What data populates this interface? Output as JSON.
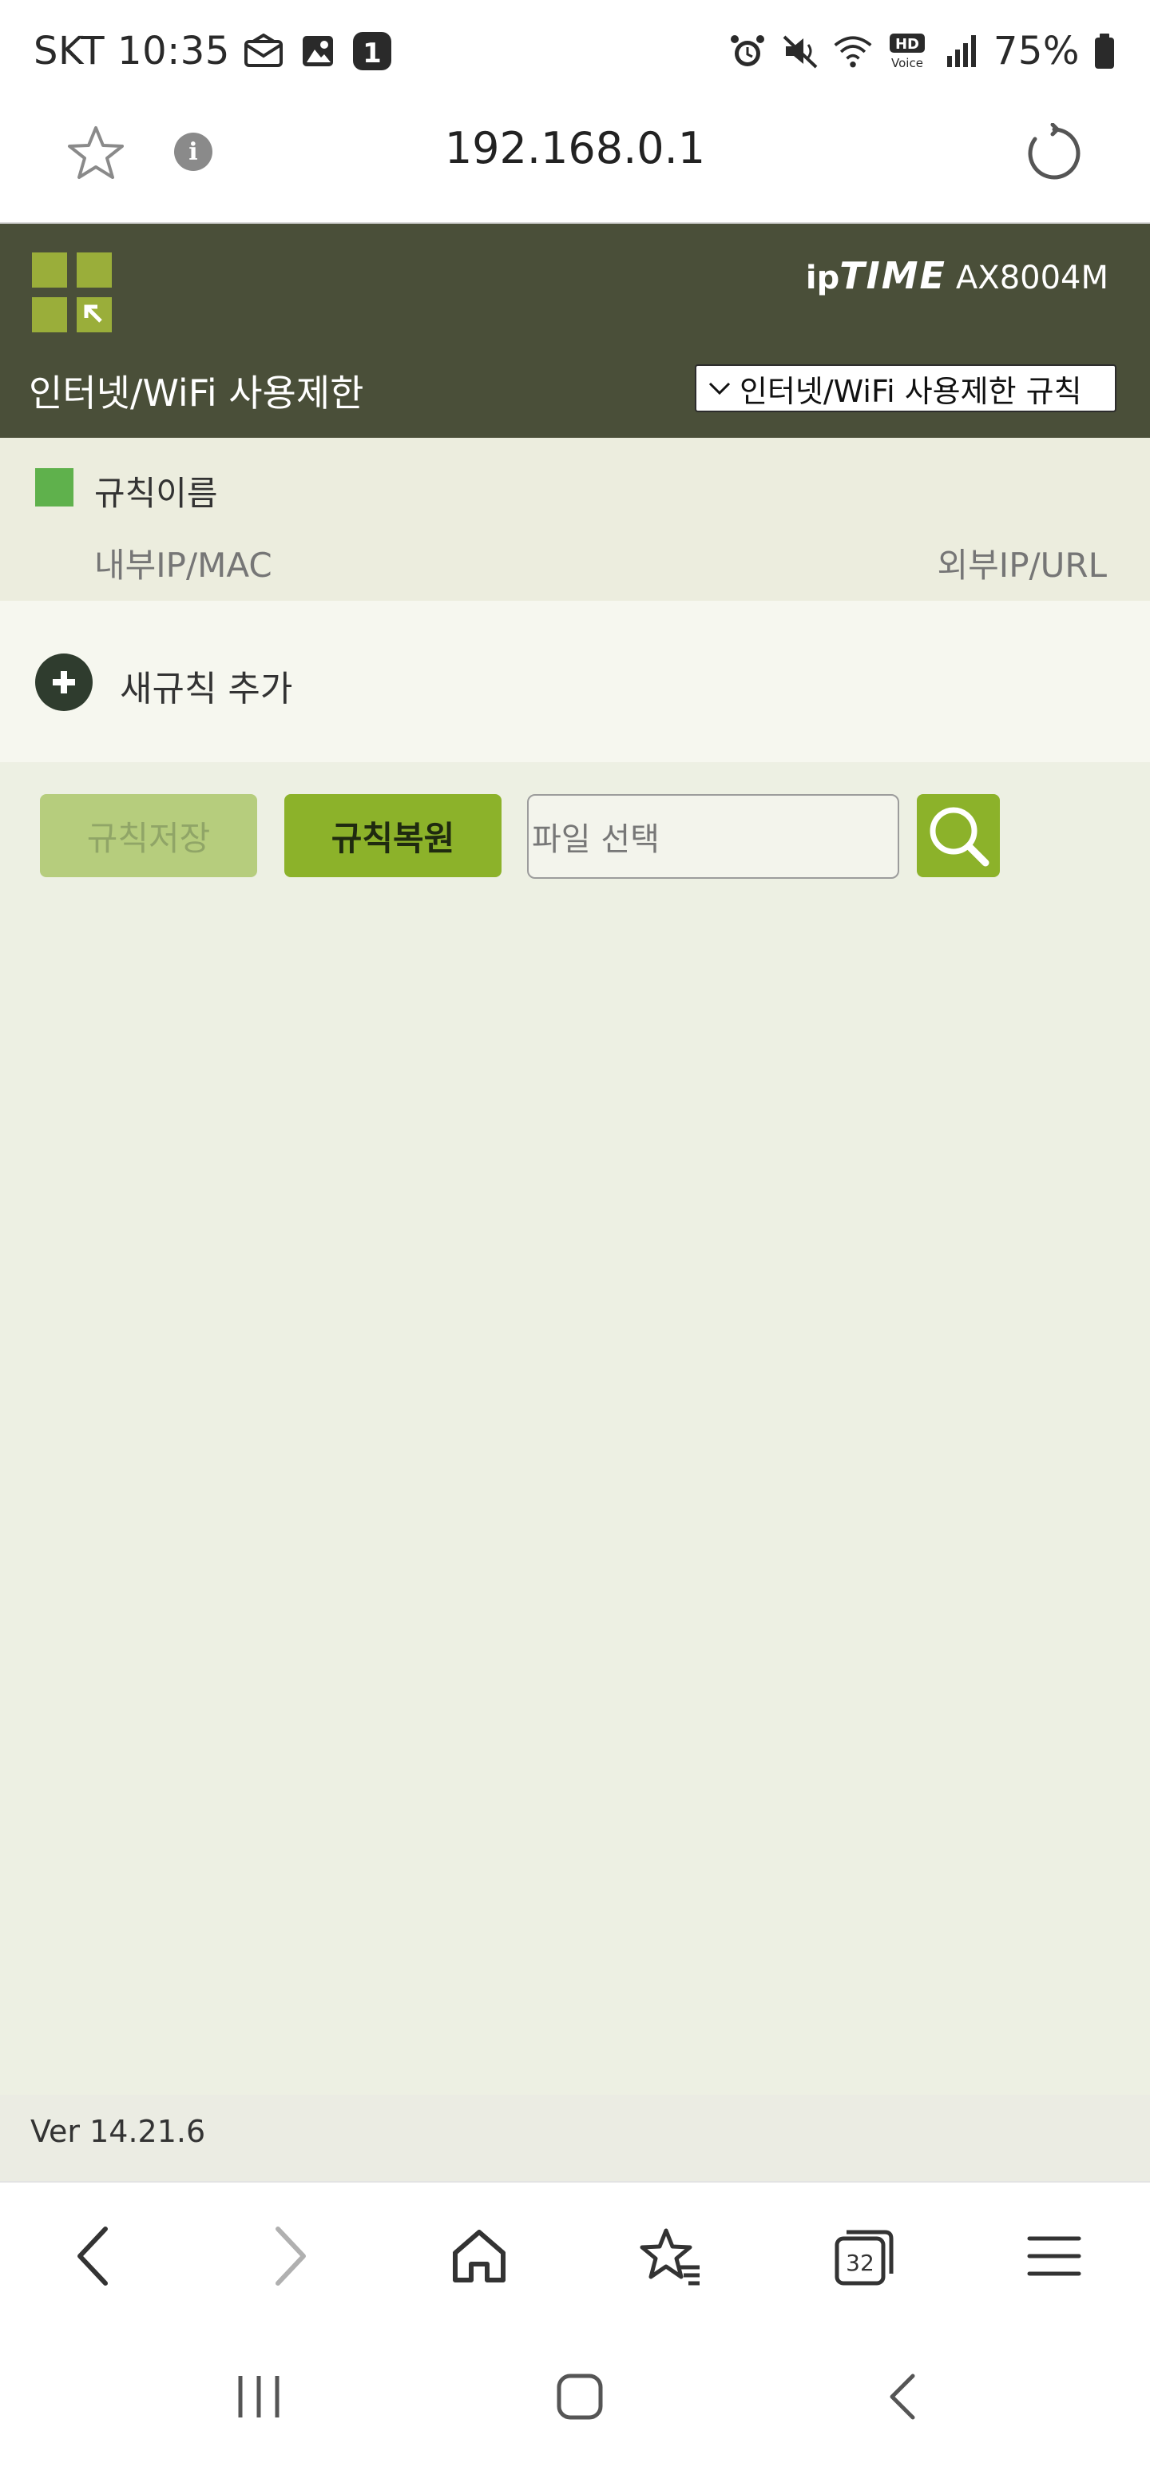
{
  "status_bar": {
    "carrier": "SKT",
    "time": "10:35",
    "battery": "75%",
    "notification_badge": "1",
    "hd_voice_label": "HD",
    "hd_voice_sub": "Voice",
    "left_icons": [
      "mail-icon",
      "image-icon",
      "badge-icon"
    ],
    "right_icons": [
      "alarm-icon",
      "mute-icon",
      "wifi-icon",
      "hd-voice-icon",
      "signal-icon",
      "battery-icon"
    ]
  },
  "browser": {
    "url": "192.168.0.1",
    "info_glyph": "i",
    "tab_count": "32"
  },
  "router": {
    "brand_prefix": "ip",
    "brand_name": "TIME",
    "model": "AX8004M",
    "page_title": "인터넷/WiFi 사용제한",
    "menu_selected": "인터넷/WiFi 사용제한 규칙",
    "rule_name_header": "규칙이름",
    "col_internal": "내부IP/MAC",
    "col_external": "외부IP/URL",
    "add_rule_label": "새규칙 추가",
    "btn_save": "규칙저장",
    "btn_restore": "규칙복원",
    "file_placeholder": "파일 선택",
    "version": "Ver 14.21.6"
  },
  "colors": {
    "header_bg": "#4a4f39",
    "accent_green": "#8cb22a",
    "logo_green": "#9aae3a",
    "rule_marker": "#5fb14c",
    "body_bg": "#edf0e3"
  }
}
